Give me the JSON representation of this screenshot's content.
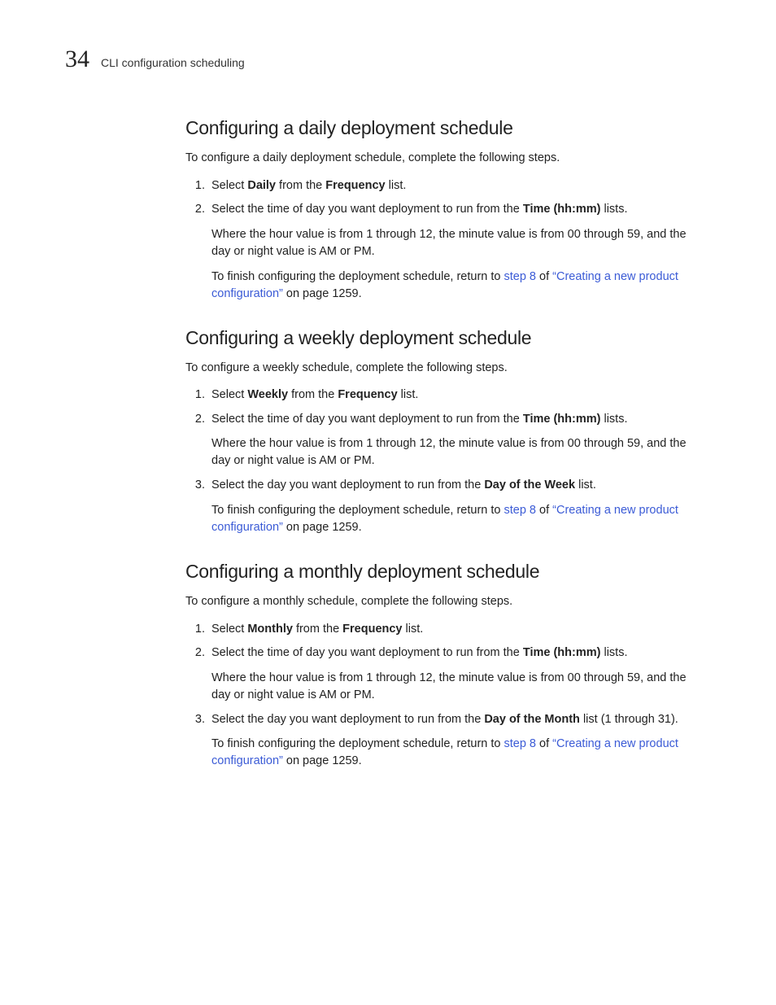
{
  "header": {
    "chapter_number": "34",
    "running_title": "CLI configuration scheduling"
  },
  "sections": [
    {
      "heading": "Configuring a daily deployment schedule",
      "intro": "To configure a daily deployment schedule, complete the following steps.",
      "steps": [
        {
          "text_pre": "Select ",
          "bold1": "Daily",
          "text_mid": " from the ",
          "bold2": "Frequency",
          "text_post": " list."
        },
        {
          "text_pre": "Select the time of day you want deployment to run from the ",
          "bold1": "Time (hh:mm)",
          "text_post": " lists.",
          "subs": [
            {
              "text": "Where the hour value is from 1 through 12, the minute value is from 00 through 59, and the day or night value is AM or PM."
            },
            {
              "return_pre": "To finish configuring the deployment schedule, return to ",
              "link1": "step 8",
              "return_mid": " of ",
              "link2": "“Creating a new product configuration”",
              "return_post": " on page 1259."
            }
          ]
        }
      ]
    },
    {
      "heading": "Configuring a weekly deployment schedule",
      "intro": "To configure a weekly schedule, complete the following steps.",
      "steps": [
        {
          "text_pre": "Select ",
          "bold1": "Weekly",
          "text_mid": " from the ",
          "bold2": "Frequency",
          "text_post": " list."
        },
        {
          "text_pre": "Select the time of day you want deployment to run from the ",
          "bold1": "Time (hh:mm)",
          "text_post": " lists.",
          "subs": [
            {
              "text": "Where the hour value is from 1 through 12, the minute value is from 00 through 59, and the day or night value is AM or PM."
            }
          ]
        },
        {
          "text_pre": "Select the day you want deployment to run from the ",
          "bold1": "Day of the Week",
          "text_post": " list.",
          "subs": [
            {
              "return_pre": "To finish configuring the deployment schedule, return to ",
              "link1": "step 8",
              "return_mid": " of ",
              "link2": "“Creating a new product configuration”",
              "return_post": " on page 1259."
            }
          ]
        }
      ]
    },
    {
      "heading": "Configuring a monthly deployment schedule",
      "intro": "To configure a monthly schedule, complete the following steps.",
      "steps": [
        {
          "text_pre": "Select ",
          "bold1": "Monthly",
          "text_mid": " from the ",
          "bold2": "Frequency",
          "text_post": " list."
        },
        {
          "text_pre": "Select the time of day you want deployment to run from the ",
          "bold1": "Time (hh:mm)",
          "text_post": " lists.",
          "subs": [
            {
              "text": "Where the hour value is from 1 through 12, the minute value is from 00 through 59, and the day or night value is AM or PM."
            }
          ]
        },
        {
          "text_pre": "Select the day you want deployment to run from the ",
          "bold1": "Day of the Month",
          "text_post": " list (1 through 31).",
          "subs": [
            {
              "return_pre": "To finish configuring the deployment schedule, return to ",
              "link1": "step 8",
              "return_mid": " of ",
              "link2": "“Creating a new product configuration”",
              "return_post": " on page 1259."
            }
          ]
        }
      ]
    }
  ]
}
